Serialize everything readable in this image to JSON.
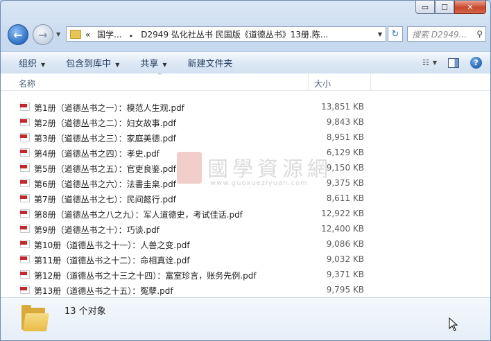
{
  "window": {
    "caption": {
      "minimize": "▭",
      "maximize": "☐",
      "close": "✕"
    }
  },
  "nav": {
    "back_glyph": "←",
    "forward_glyph": "→",
    "dropdown_glyph": "▼"
  },
  "address": {
    "prefix": "«",
    "segment1": "国学...",
    "separator": "▸",
    "segment2": "D2949 弘化社丛书 民国版《道德丛书》13册.陈...",
    "dropdown_glyph": "▼"
  },
  "refresh_glyph": "↻",
  "search": {
    "placeholder": "搜索 D2949...",
    "icon": "search-icon"
  },
  "toolbar": {
    "organize": "组织",
    "include_in_library": "包含到库中",
    "share": "共享",
    "new_folder": "新建文件夹",
    "dropdown_glyph": "▼",
    "view_glyph": "☷",
    "help_glyph": "?"
  },
  "columns": {
    "name": "名称",
    "size": "大小",
    "sort_glyph": "^"
  },
  "files": [
    {
      "name": "第1册（道德丛书之一）：模范人生观.pdf",
      "size": "13,851 KB"
    },
    {
      "name": "第2册（道德丛书之二）：妇女故事.pdf",
      "size": "9,843 KB"
    },
    {
      "name": "第3册（道德丛书之三）：家庭美德.pdf",
      "size": "8,951 KB"
    },
    {
      "name": "第4册（道德丛书之四）：孝史.pdf",
      "size": "6,129 KB"
    },
    {
      "name": "第5册（道德丛书之五）：官吏良鉴.pdf",
      "size": "9,150 KB"
    },
    {
      "name": "第6册（道德丛书之六）：法書圭臬.pdf",
      "size": "9,375 KB"
    },
    {
      "name": "第7册（道德丛书之七）：民间懿行.pdf",
      "size": "8,611 KB"
    },
    {
      "name": "第8册（道德丛书之八之九）：军人道德史，考试佳话.pdf",
      "size": "12,922 KB"
    },
    {
      "name": "第9册（道德丛书之十）：巧谈.pdf",
      "size": "12,400 KB"
    },
    {
      "name": "第10册（道德丛书之十一）：人兽之变.pdf",
      "size": "9,086 KB"
    },
    {
      "name": "第11册（道德丛书之十二）：命相真诠.pdf",
      "size": "9,032 KB"
    },
    {
      "name": "第12册（道德丛书之十三之十四）：富室珍言，账务先例.pdf",
      "size": "9,371 KB"
    },
    {
      "name": "第13册（道德丛书之十五）：冤孽.pdf",
      "size": "9,795 KB"
    }
  ],
  "watermark": {
    "title": "國學資源網",
    "url": "www.guoxueziyuan.com"
  },
  "status": {
    "count_text": "13 个对象"
  }
}
